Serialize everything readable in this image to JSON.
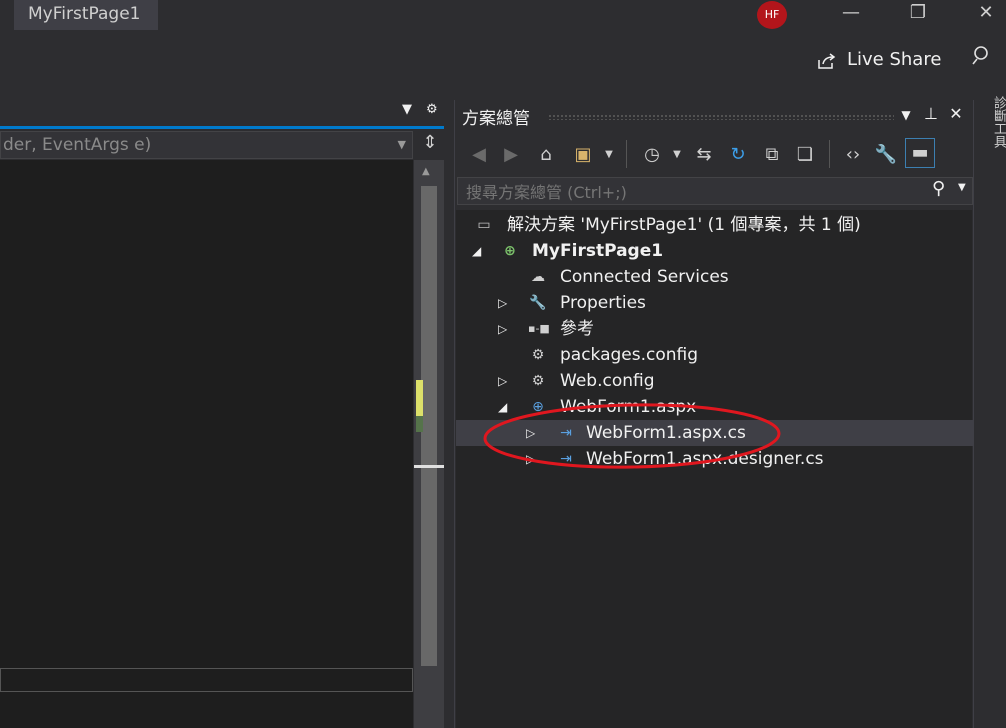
{
  "window": {
    "title": "MyFirstPage1",
    "avatar_initials": "HF",
    "live_share": "Live Share"
  },
  "editor": {
    "member_dropdown": "der, EventArgs e)"
  },
  "solution_explorer": {
    "title": "方案總管",
    "search_placeholder": "搜尋方案總管 (Ctrl+;)",
    "tree": [
      {
        "label": "解決方案 'MyFirstPage1' (1 個專案，共 1 個)",
        "icon": "solution-icon",
        "expander": ""
      },
      {
        "label": "MyFirstPage1",
        "icon": "web-project-icon",
        "expander": "expanded",
        "bold": true
      },
      {
        "label": "Connected Services",
        "icon": "cloud-icon",
        "expander": ""
      },
      {
        "label": "Properties",
        "icon": "wrench-icon",
        "expander": "collapsed"
      },
      {
        "label": "參考",
        "icon": "references-icon",
        "expander": "collapsed"
      },
      {
        "label": "packages.config",
        "icon": "config-file-icon",
        "expander": ""
      },
      {
        "label": "Web.config",
        "icon": "config-file-icon",
        "expander": "collapsed"
      },
      {
        "label": "WebForm1.aspx",
        "icon": "aspx-file-icon",
        "expander": "expanded"
      },
      {
        "label": "WebForm1.aspx.cs",
        "icon": "cs-file-icon",
        "expander": "collapsed",
        "selected": true
      },
      {
        "label": "WebForm1.aspx.designer.cs",
        "icon": "cs-file-icon",
        "expander": "collapsed"
      }
    ]
  },
  "right_rail": {
    "label": "診斷工具"
  },
  "colors": {
    "accent": "#007acc",
    "annotation": "#e0171f",
    "avatar": "#b3151b"
  }
}
